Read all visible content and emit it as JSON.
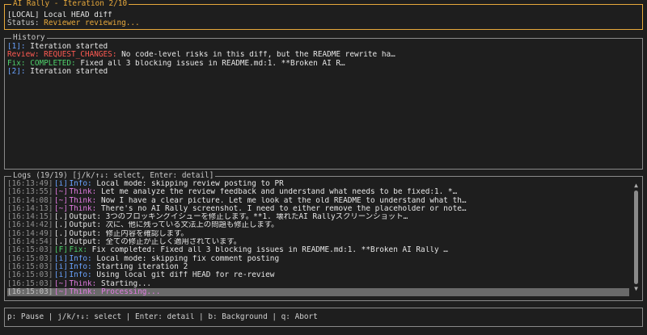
{
  "header": {
    "title": "AI Rally - Iteration 2/10",
    "mode_line": "[LOCAL] Local HEAD diff",
    "status_label": "Status:",
    "status_value": "Reviewer reviewing..."
  },
  "history": {
    "title": "History",
    "items": [
      {
        "tag": "[1]:",
        "text": "Iteration started",
        "tag_color": "#6aa3ff"
      },
      {
        "tag": "Review: REQUEST_CHANGES:",
        "text": "No code-level risks in this diff, but the README rewrite ha…",
        "tag_color": "#ff5a52"
      },
      {
        "tag": "Fix: COMPLETED:",
        "text": "Fixed all 3 blocking issues in README.md:1. **Broken AI R…",
        "tag_color": "#4fd06b"
      },
      {
        "tag": "[2]:",
        "text": "Iteration started",
        "tag_color": "#6aa3ff"
      }
    ]
  },
  "logs": {
    "title": "Logs (19/19) [j/k/↑↓: select, Enter: detail]",
    "selected_index": 12,
    "entries": [
      {
        "ts": "[16:13:49]",
        "lvl": "[i]",
        "kind": "Info:",
        "text": "Local mode: skipping review posting to PR",
        "color": "#6aa3ff"
      },
      {
        "ts": "[16:13:55]",
        "lvl": "[~]",
        "kind": "Think:",
        "text": "Let me analyze the review feedback and understand what needs to be fixed:1. *…",
        "color": "#e07ce0"
      },
      {
        "ts": "[16:14:08]",
        "lvl": "[~]",
        "kind": "Think:",
        "text": "Now I have a clear picture. Let me look at the old README to understand what th…",
        "color": "#e07ce0"
      },
      {
        "ts": "[16:14:13]",
        "lvl": "[~]",
        "kind": "Think:",
        "text": "There's no AI Rally screenshot. I need to either remove the placeholder or note…",
        "color": "#e07ce0"
      },
      {
        "ts": "[16:14:15]",
        "lvl": "[.]",
        "kind": "Output:",
        "text": "3つのブロッキングイシューを修正します。**1. 壊れたAI Rallyスクリーンショット…",
        "color": "#e6e6e6"
      },
      {
        "ts": "[16:14:42]",
        "lvl": "[.]",
        "kind": "Output:",
        "text": "次に、他に残っている文法上の問題も修正します。",
        "color": "#e6e6e6"
      },
      {
        "ts": "[16:14:49]",
        "lvl": "[.]",
        "kind": "Output:",
        "text": "修正内容を確認します。",
        "color": "#e6e6e6"
      },
      {
        "ts": "[16:14:54]",
        "lvl": "[.]",
        "kind": "Output:",
        "text": "全ての修正が正しく適用されています。",
        "color": "#e6e6e6"
      },
      {
        "ts": "[16:15:03]",
        "lvl": "[F]",
        "kind": "Fix:",
        "text": "Fix completed: Fixed all 3 blocking issues in README.md:1. **Broken AI Rally …",
        "color": "#4fd06b"
      },
      {
        "ts": "[16:15:03]",
        "lvl": "[i]",
        "kind": "Info:",
        "text": "Local mode: skipping fix comment posting",
        "color": "#6aa3ff"
      },
      {
        "ts": "[16:15:03]",
        "lvl": "[i]",
        "kind": "Info:",
        "text": "Starting iteration 2",
        "color": "#6aa3ff"
      },
      {
        "ts": "[16:15:03]",
        "lvl": "[i]",
        "kind": "Info:",
        "text": "Using local git diff HEAD for re-review",
        "color": "#6aa3ff"
      },
      {
        "ts": "[16:15:03]",
        "lvl": "[~]",
        "kind": "Think:",
        "text": "Starting...",
        "color": "#e07ce0"
      },
      {
        "ts": "[16:15:03]",
        "lvl": "[~]",
        "kind": "Think:",
        "text": "Processing...",
        "color": "#e07ce0"
      }
    ],
    "cursor_marker": "▸",
    "scroll_position": 1.0
  },
  "footer": {
    "text": "p: Pause | j/k/↑↓: select | Enter: detail | b: Background | q: Abort"
  },
  "icons": {
    "scroll_up": "▲",
    "scroll_down": "▼"
  }
}
